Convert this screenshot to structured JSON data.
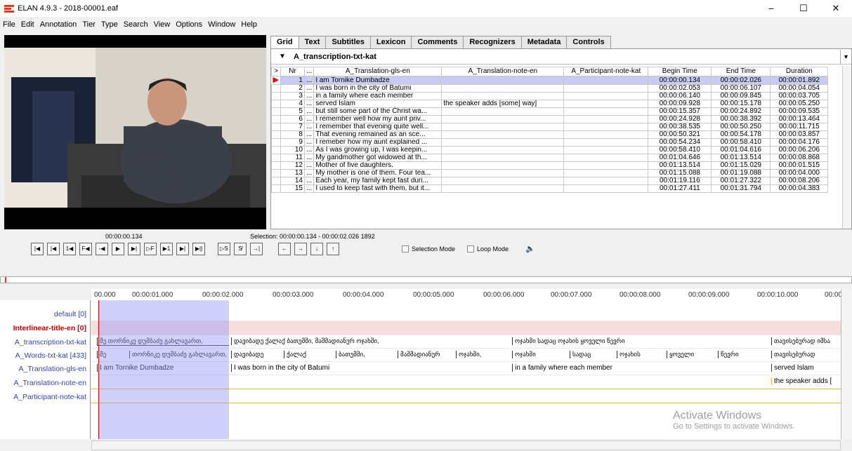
{
  "window": {
    "title": "ELAN 4.9.3 - 2018-00001.eaf",
    "minimize": "–",
    "maximize": "☐",
    "close": "✕"
  },
  "menu": [
    "File",
    "Edit",
    "Annotation",
    "Tier",
    "Type",
    "Search",
    "View",
    "Options",
    "Window",
    "Help"
  ],
  "tabs": [
    "Grid",
    "Text",
    "Subtitles",
    "Lexicon",
    "Comments",
    "Recognizers",
    "Metadata",
    "Controls"
  ],
  "grid": {
    "tier": "A_transcription-txt-kat",
    "columns": [
      ">",
      "Nr",
      "...",
      "A_Translation-gls-en",
      "A_Translation-note-en",
      "A_Participant-note-kat",
      "Begin Time",
      "End Time",
      "Duration"
    ],
    "rows": [
      {
        "nr": "1",
        "dots": "...",
        "gls": "I am Tornike Dumbadze",
        "note": "",
        "part": "",
        "begin": "00:00:00.134",
        "end": "00:00:02.026",
        "dur": "00:00:01.892"
      },
      {
        "nr": "2",
        "dots": "...",
        "gls": "I was born in the city of Batumi",
        "note": "",
        "part": "",
        "begin": "00:00:02.053",
        "end": "00:00:06.107",
        "dur": "00:00:04.054"
      },
      {
        "nr": "3",
        "dots": "...",
        "gls": "in a family where each member",
        "note": "",
        "part": "",
        "begin": "00:00:06.140",
        "end": "00:00:09.845",
        "dur": "00:00:03.705"
      },
      {
        "nr": "4",
        "dots": "...",
        "gls": "served Islam",
        "note": "the speaker adds [some] way]",
        "part": "",
        "begin": "00:00:09.928",
        "end": "00:00:15.178",
        "dur": "00:00:05.250"
      },
      {
        "nr": "5",
        "dots": "...",
        "gls": "but still some part of the Christ wa...",
        "note": "",
        "part": "",
        "begin": "00:00:15.357",
        "end": "00:00:24.892",
        "dur": "00:00:09.535"
      },
      {
        "nr": "6",
        "dots": "...",
        "gls": "I remember well how my aunt  priv...",
        "note": "",
        "part": "",
        "begin": "00:00:24.928",
        "end": "00:00:38.392",
        "dur": "00:00:13.464"
      },
      {
        "nr": "7",
        "dots": "...",
        "gls": "I remember that evening quite well...",
        "note": "",
        "part": "",
        "begin": "00:00:38.535",
        "end": "00:00:50.250",
        "dur": "00:00:11.715"
      },
      {
        "nr": "8",
        "dots": "...",
        "gls": "That evening remained as an sce...",
        "note": "",
        "part": "",
        "begin": "00:00:50.321",
        "end": "00:00:54.178",
        "dur": "00:00:03.857"
      },
      {
        "nr": "9",
        "dots": "...",
        "gls": "I remeber how my aunt explained ...",
        "note": "",
        "part": "",
        "begin": "00:00:54.234",
        "end": "00:00:58.410",
        "dur": "00:00:04.176"
      },
      {
        "nr": "10",
        "dots": "...",
        "gls": "As I was growing up, I was keepin...",
        "note": "",
        "part": "",
        "begin": "00:00:58.410",
        "end": "00:01:04.616",
        "dur": "00:00:06.206"
      },
      {
        "nr": "11",
        "dots": "...",
        "gls": "My gandmother got widowed at th...",
        "note": "",
        "part": "",
        "begin": "00:01:04.646",
        "end": "00:01:13.514",
        "dur": "00:00:08.868"
      },
      {
        "nr": "12",
        "dots": "...",
        "gls": "Mother of five daughters.",
        "note": "",
        "part": "",
        "begin": "00:01:13.514",
        "end": "00:01:15.029",
        "dur": "00:00:01.515"
      },
      {
        "nr": "13",
        "dots": "...",
        "gls": "My mother is one of them. Four tea...",
        "note": "",
        "part": "",
        "begin": "00:01:15.088",
        "end": "00:01:19.088",
        "dur": "00:00:04.000"
      },
      {
        "nr": "14",
        "dots": "...",
        "gls": "Each year, my family kept fast duri...",
        "note": "",
        "part": "",
        "begin": "00:01:19.116",
        "end": "00:01:27.322",
        "dur": "00:00:08.206"
      },
      {
        "nr": "15",
        "dots": "...",
        "gls": "I used to keep fast with them, but it...",
        "note": "",
        "part": "",
        "begin": "00:01:27.411",
        "end": "00:01:31.794",
        "dur": "00:00:04.383"
      }
    ]
  },
  "player": {
    "time": "00:00:00.134",
    "selection": "Selection: 00:00:00.134 - 00:00:02.026  1892",
    "selection_mode": "Selection Mode",
    "loop_mode": "Loop Mode"
  },
  "ruler": [
    "00.000",
    "00:00:01.000",
    "00:00:02.000",
    "00:00:03.000",
    "00:00:04.000",
    "00:00:05.000",
    "00:00:06.000",
    "00:00:07.000",
    "00:00:08.000",
    "00:00:09.000",
    "00:00:10.000",
    "00:00"
  ],
  "tiers": [
    "default [0]",
    "Interlinear-title-en [0]",
    "A_transcription-txt-kat",
    "A_Words-txt-kat [433]",
    "A_Translation-gls-en",
    "A_Translation-note-en",
    "A_Participant-note-kat"
  ],
  "annotations": {
    "transcription": [
      "მე თორნიკე დუმბაძე გახლავართ,",
      "დავიბადე ქალაქ ბათუმში, მაშმადიანურ ოჯახში,",
      "ოჯახში  სადაც ოჯახის ყოველი წევრი",
      "თავისებურად იმსა"
    ],
    "words": [
      "მე",
      "თორნიკე დუმბაძე გახლავართ,",
      "დავიბადე",
      "ქალაქ",
      "ბათუმში,",
      "მაშმადიანურ",
      "ოჯახში,",
      "ოჯახში",
      "სადაც",
      "ოჯახის",
      "ყოველი",
      "წევრი",
      "თავისებურად"
    ],
    "gls": [
      "I am Tornike Dumbadze",
      "I was born in the city of Batumi",
      "in a family where each member",
      "served Islam"
    ],
    "note": [
      "the speaker adds ["
    ]
  },
  "watermark": {
    "line1": "Activate Windows",
    "line2": "Go to Settings to activate Windows."
  },
  "colors": {
    "selection": "#c9cbf0",
    "accent": "#e23a1f",
    "tier_label": "#3344aa"
  }
}
